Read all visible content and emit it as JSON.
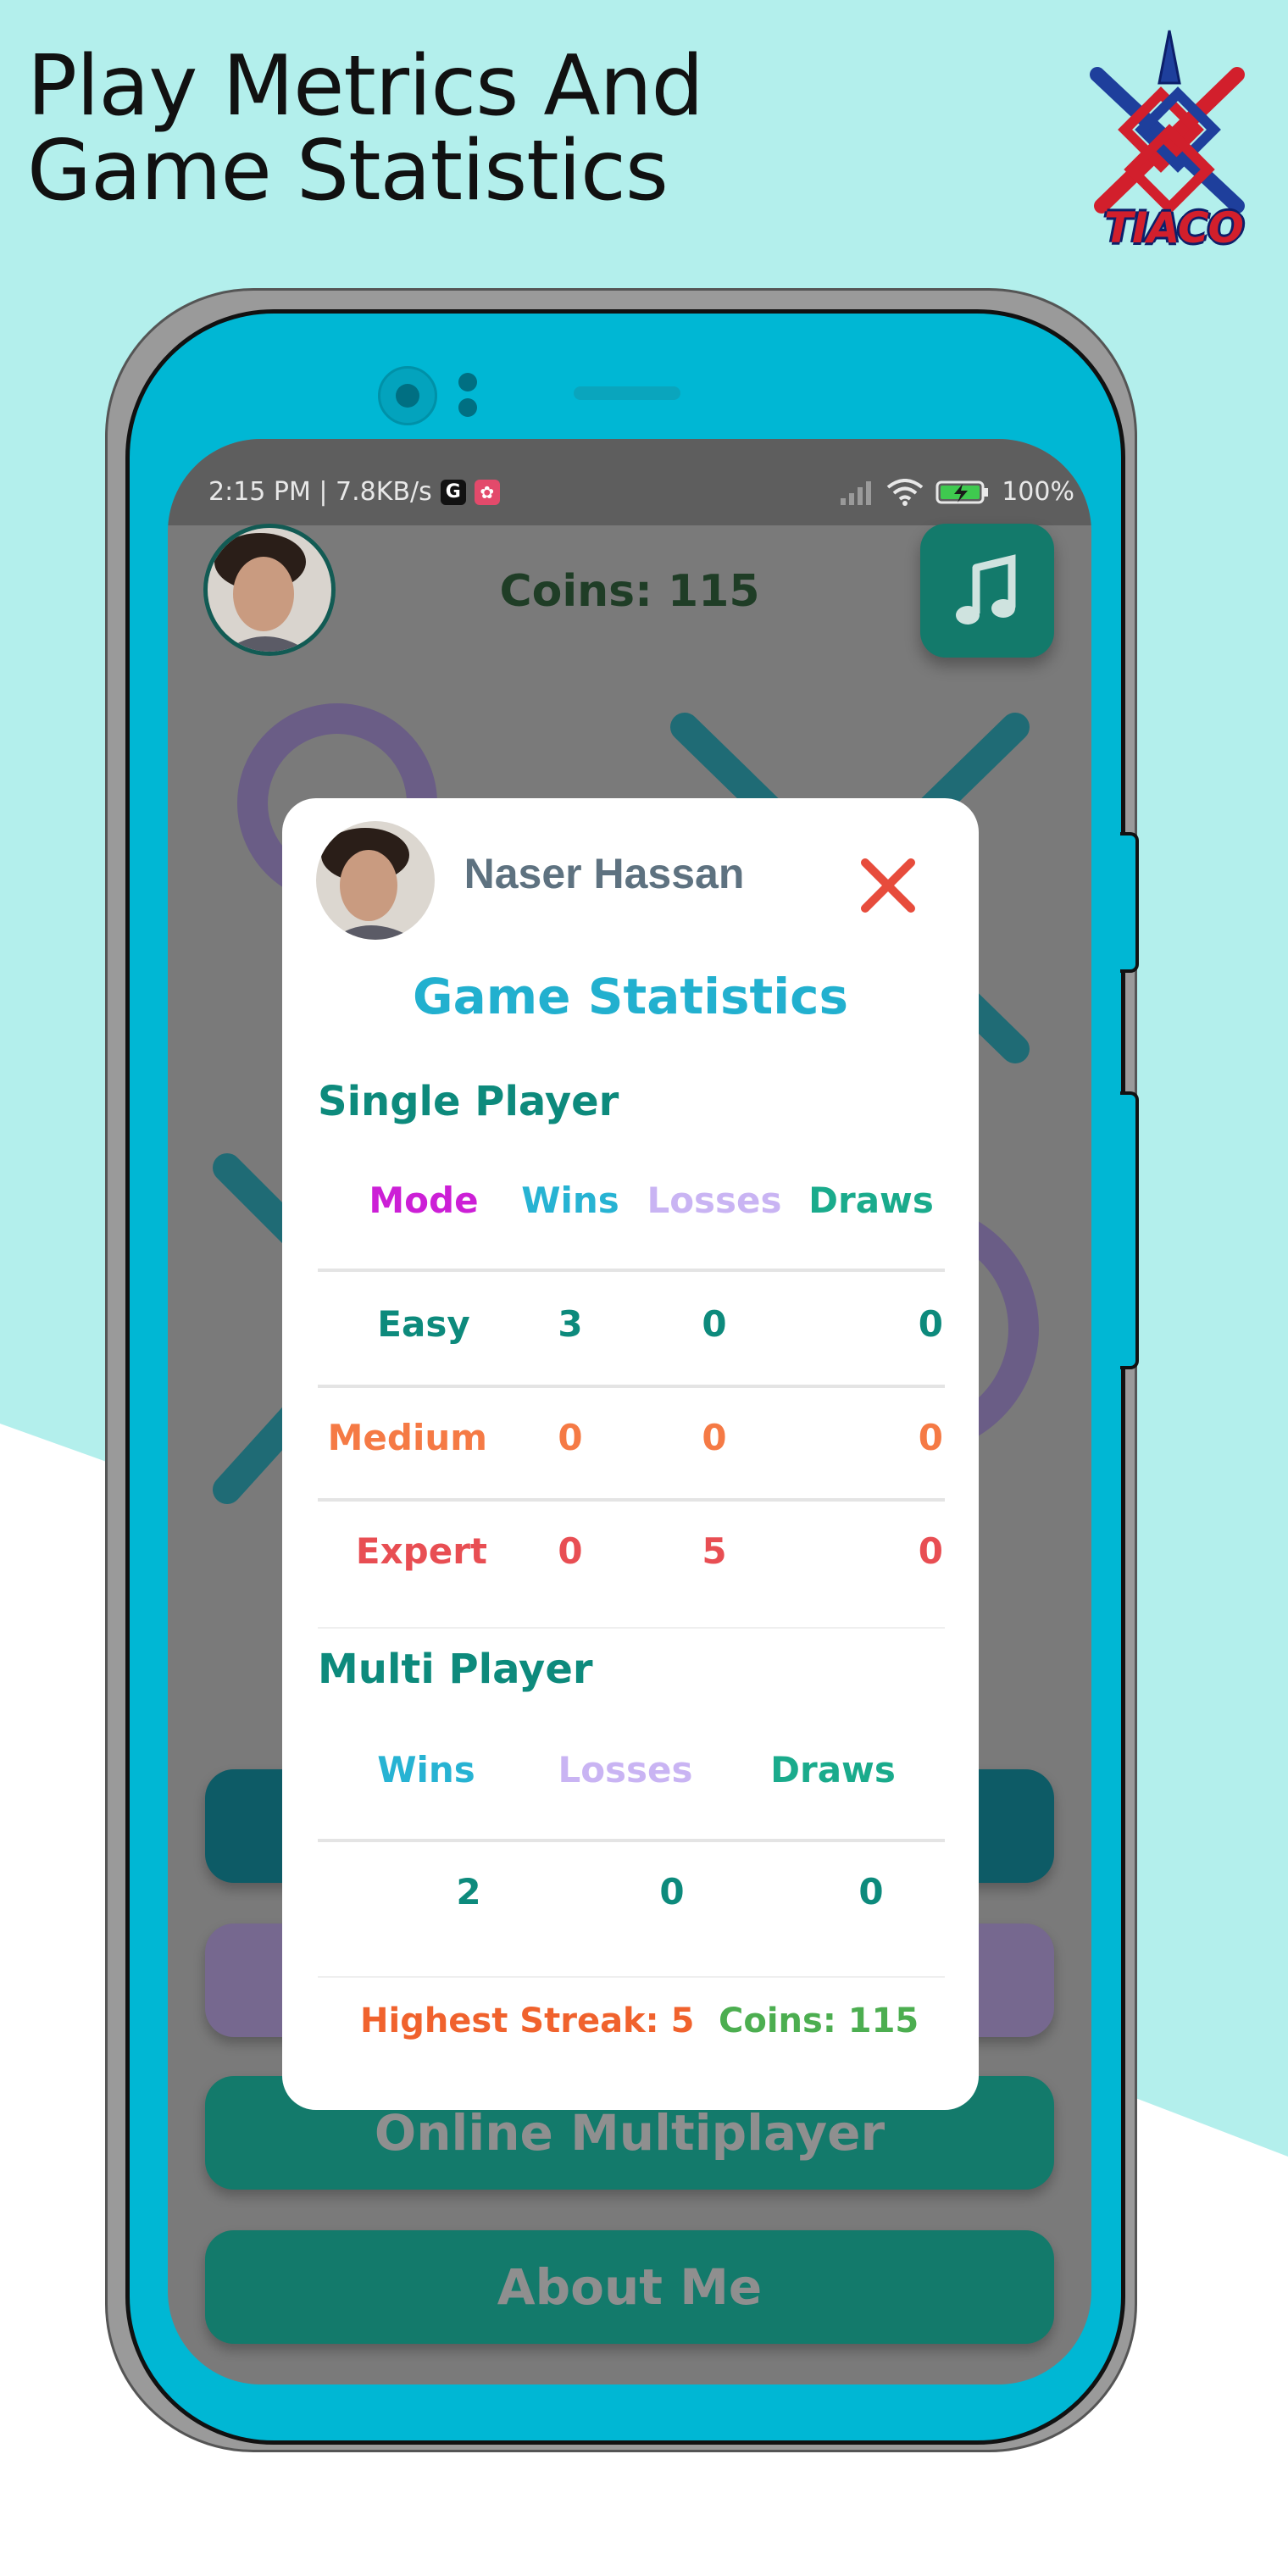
{
  "headline": {
    "line1": "Play Metrics And",
    "line2": "Game Statistics"
  },
  "logo": {
    "text": "TIACO"
  },
  "status_bar": {
    "time_info": "2:15 PM | 7.8KB/s",
    "g_badge": "G",
    "battery": "100%"
  },
  "home": {
    "coins": "Coins: 115",
    "buttons": [
      "",
      "",
      "Online Multiplayer",
      "About Me"
    ]
  },
  "dialog": {
    "player_name": "Naser Hassan",
    "title": "Game Statistics",
    "single": {
      "heading": "Single Player",
      "headers": {
        "mode": "Mode",
        "wins": "Wins",
        "losses": "Losses",
        "draws": "Draws"
      },
      "rows": [
        {
          "mode": "Easy",
          "wins": "3",
          "losses": "0",
          "draws": "0"
        },
        {
          "mode": "Medium",
          "wins": "0",
          "losses": "0",
          "draws": "0"
        },
        {
          "mode": "Expert",
          "wins": "0",
          "losses": "5",
          "draws": "0"
        }
      ]
    },
    "multi": {
      "heading": "Multi Player",
      "headers": {
        "wins": "Wins",
        "losses": "Losses",
        "draws": "Draws"
      },
      "row": {
        "wins": "2",
        "losses": "0",
        "draws": "0"
      }
    },
    "footer": {
      "streak": "Highest Streak: 5",
      "coins": "Coins: 115"
    }
  },
  "colors": {
    "teal_bg": "#b3efec",
    "phone": "#00b7d4",
    "title": "#22b0cf",
    "section": "#0d8a7c",
    "mode_header": "#cc1fd6",
    "wins_header": "#27b3d3",
    "losses_header": "#c9b4f3",
    "draws_header": "#1aab8c",
    "easy": "#0d8a7c",
    "medium": "#f57a45",
    "expert": "#e84e53",
    "streak": "#f0622d",
    "coins": "#4cae50",
    "close": "#e74c3c"
  }
}
